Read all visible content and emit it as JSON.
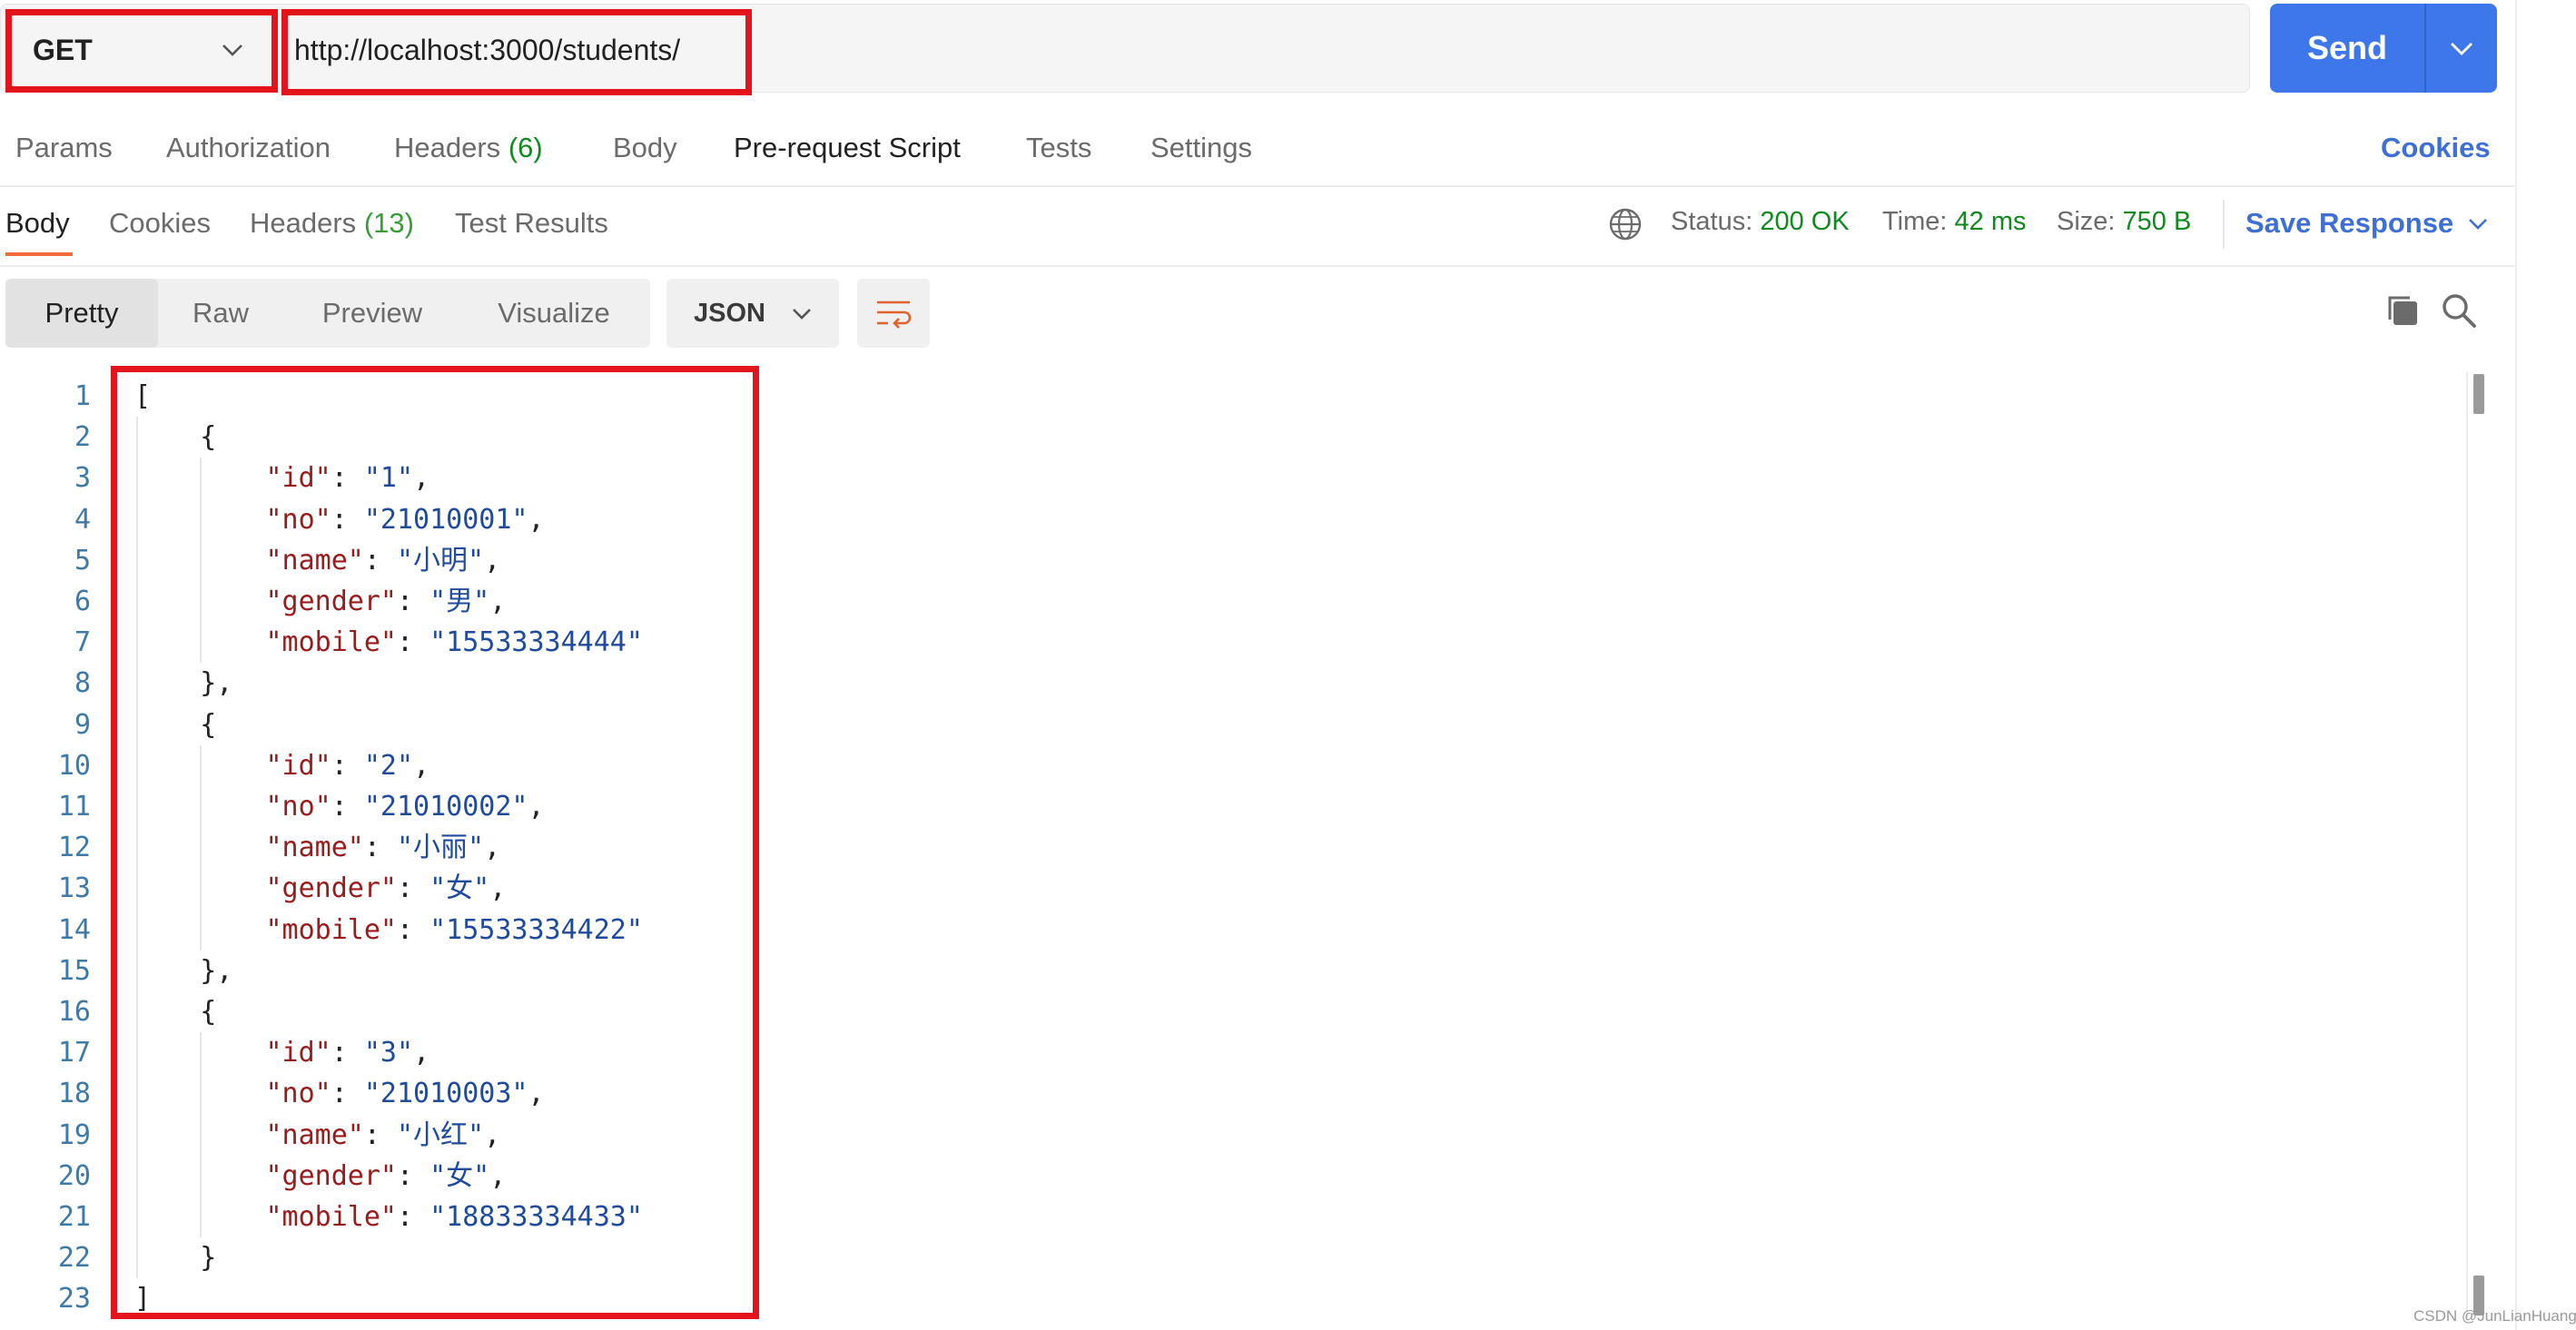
{
  "request": {
    "method": "GET",
    "url": "http://localhost:3000/students/",
    "send_label": "Send"
  },
  "request_tabs": {
    "params": "Params",
    "authorization": "Authorization",
    "headers": "Headers",
    "headers_count": "(6)",
    "body": "Body",
    "prerequest": "Pre-request Script",
    "tests": "Tests",
    "settings": "Settings",
    "cookies": "Cookies"
  },
  "response_tabs": {
    "body": "Body",
    "cookies": "Cookies",
    "headers": "Headers",
    "headers_count": "(13)",
    "test_results": "Test Results"
  },
  "response_meta": {
    "status_label": "Status:",
    "status_value": "200 OK",
    "time_label": "Time:",
    "time_value": "42 ms",
    "size_label": "Size:",
    "size_value": "750 B",
    "save_response": "Save Response"
  },
  "view_modes": {
    "pretty": "Pretty",
    "raw": "Raw",
    "preview": "Preview",
    "visualize": "Visualize",
    "format": "JSON"
  },
  "students": [
    {
      "id": "1",
      "no": "21010001",
      "name": "小明",
      "gender": "男",
      "mobile": "15533334444"
    },
    {
      "id": "2",
      "no": "21010002",
      "name": "小丽",
      "gender": "女",
      "mobile": "15533334422"
    },
    {
      "id": "3",
      "no": "21010003",
      "name": "小红",
      "gender": "女",
      "mobile": "18833334433"
    }
  ],
  "watermark": "CSDN @JunLianHuang",
  "colors": {
    "accent_blue": "#3d77e9",
    "status_green": "#0f8a1e",
    "annotation_red": "#e3141c",
    "tab_underline": "#f26b3a"
  }
}
